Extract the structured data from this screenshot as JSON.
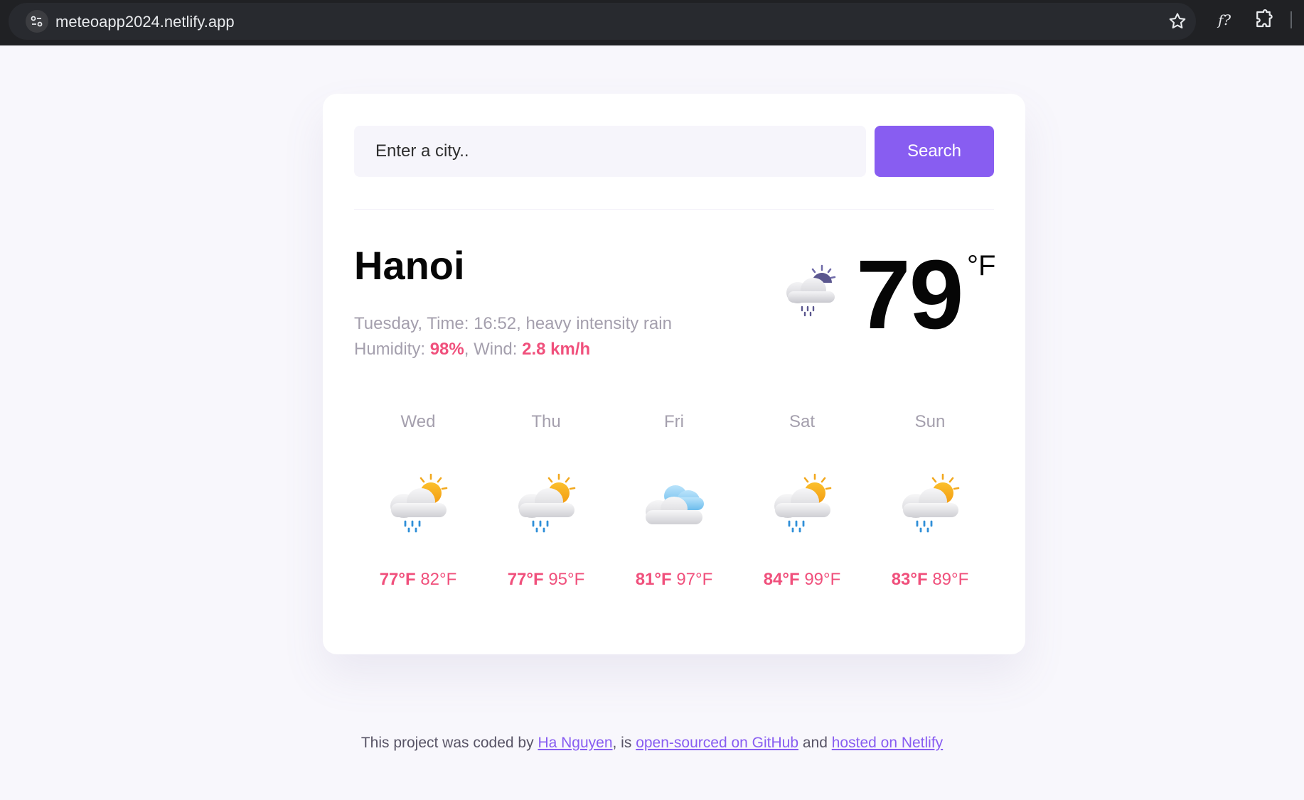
{
  "browser": {
    "url": "meteoapp2024.netlify.app",
    "extension_label": "f?"
  },
  "search": {
    "placeholder": "Enter a city..",
    "button_label": "Search"
  },
  "current": {
    "city": "Hanoi",
    "day_label": "Tuesday",
    "time_label": "Time:",
    "time": "16:52",
    "description": "heavy intensity rain",
    "humidity_label": "Humidity:",
    "humidity": "98%",
    "wind_label": "Wind:",
    "wind": "2.8 km/h",
    "temperature": "79",
    "unit": "°F",
    "icon": "night-cloud-rain-icon"
  },
  "forecast": [
    {
      "day": "Wed",
      "min": "77°F",
      "max": "82°F",
      "icon": "sun-cloud-rain-icon"
    },
    {
      "day": "Thu",
      "min": "77°F",
      "max": "95°F",
      "icon": "sun-cloud-rain-icon"
    },
    {
      "day": "Fri",
      "min": "81°F",
      "max": "97°F",
      "icon": "clouds-icon"
    },
    {
      "day": "Sat",
      "min": "84°F",
      "max": "99°F",
      "icon": "sun-cloud-rain-icon"
    },
    {
      "day": "Sun",
      "min": "83°F",
      "max": "89°F",
      "icon": "sun-cloud-rain-icon"
    }
  ],
  "footer": {
    "prefix": "This project was coded by",
    "author": "Ha Nguyen",
    "mid1": ", is",
    "github": "open-sourced on GitHub",
    "mid2": "and",
    "netlify": "hosted on Netlify"
  },
  "colors": {
    "accent": "#885df1",
    "highlight": "#f0507c",
    "muted": "#a49fad",
    "background": "#f8f7fc"
  }
}
